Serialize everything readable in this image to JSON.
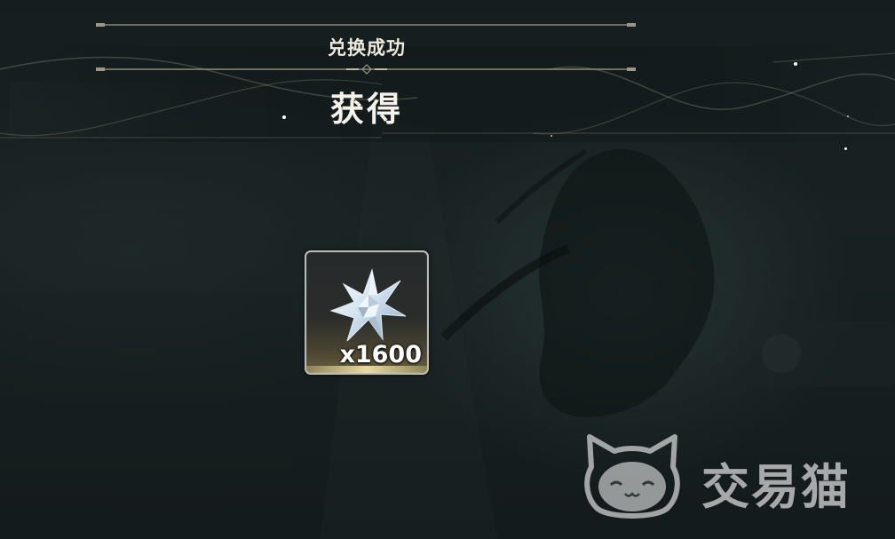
{
  "dialog": {
    "subtitle": "兑换成功",
    "title": "获得"
  },
  "reward": {
    "item_icon": "crystal-star-icon",
    "quantity": "x1600"
  },
  "watermark": {
    "logo_icon": "cat-logo-icon",
    "text": "交易猫"
  },
  "colors": {
    "accent_line": "#8c8a78",
    "card_border": "#b8bab6",
    "card_glow": "#f0dc96"
  }
}
